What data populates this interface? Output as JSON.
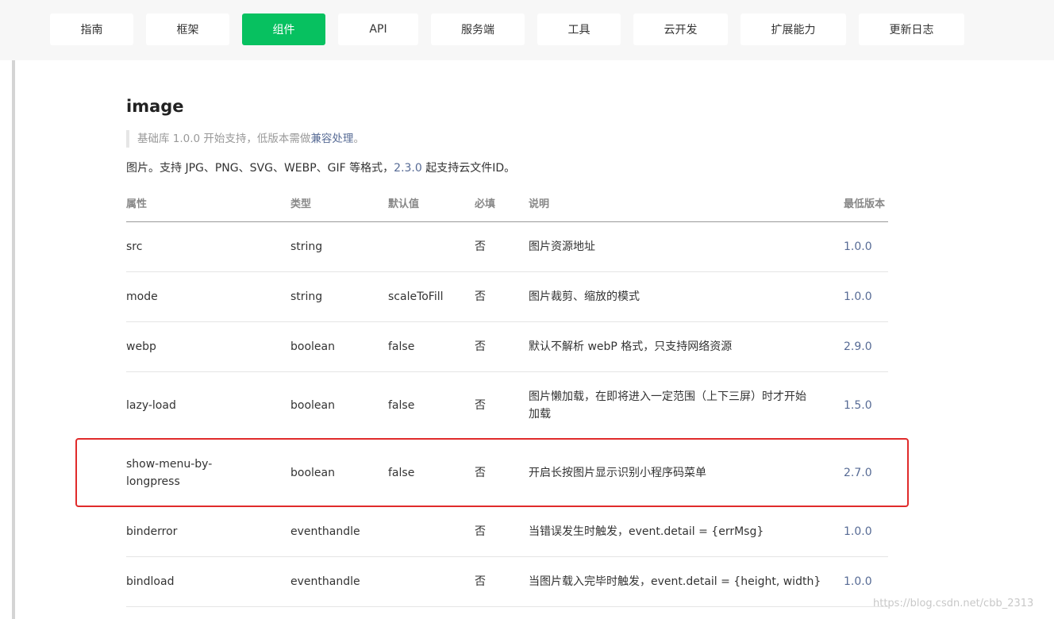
{
  "nav": {
    "items": [
      {
        "label": "指南",
        "active": false
      },
      {
        "label": "框架",
        "active": false
      },
      {
        "label": "组件",
        "active": true
      },
      {
        "label": "API",
        "active": false
      },
      {
        "label": "服务端",
        "active": false
      },
      {
        "label": "工具",
        "active": false
      },
      {
        "label": "云开发",
        "active": false
      },
      {
        "label": "扩展能力",
        "active": false
      },
      {
        "label": "更新日志",
        "active": false
      }
    ]
  },
  "page": {
    "title": "image",
    "note_prefix": "基础库 1.0.0 开始支持，低版本需做",
    "note_link": "兼容处理",
    "note_suffix": "。",
    "desc_prefix": "图片。支持 JPG、PNG、SVG、WEBP、GIF 等格式，",
    "desc_version": "2.3.0",
    "desc_suffix": " 起支持云文件ID。"
  },
  "table": {
    "headers": {
      "attr": "属性",
      "type": "类型",
      "default": "默认值",
      "required": "必填",
      "description": "说明",
      "min_version": "最低版本"
    },
    "rows": [
      {
        "attr": "src",
        "type": "string",
        "default": "",
        "required": "否",
        "description": "图片资源地址",
        "min_version": "1.0.0"
      },
      {
        "attr": "mode",
        "type": "string",
        "default": "scaleToFill",
        "required": "否",
        "description": "图片裁剪、缩放的模式",
        "min_version": "1.0.0"
      },
      {
        "attr": "webp",
        "type": "boolean",
        "default": "false",
        "required": "否",
        "description": "默认不解析 webP 格式，只支持网络资源",
        "min_version": "2.9.0"
      },
      {
        "attr": "lazy-load",
        "type": "boolean",
        "default": "false",
        "required": "否",
        "description": "图片懒加载，在即将进入一定范围（上下三屏）时才开始加载",
        "description_line1": "图片懒加载，在即将进入一定范围（上下三屏）时才开始",
        "description_line2": "加载",
        "min_version": "1.5.0"
      },
      {
        "attr": "show-menu-by-longpress",
        "attr_line1": "show-menu-by-",
        "attr_line2": "longpress",
        "type": "boolean",
        "default": "false",
        "required": "否",
        "description": "开启长按图片显示识别小程序码菜单",
        "min_version": "2.7.0"
      },
      {
        "attr": "binderror",
        "type": "eventhandle",
        "default": "",
        "required": "否",
        "description": "当错误发生时触发，event.detail = {errMsg}",
        "min_version": "1.0.0"
      },
      {
        "attr": "bindload",
        "type": "eventhandle",
        "default": "",
        "required": "否",
        "description": "当图片载入完毕时触发，event.detail = {height, width}",
        "min_version": "1.0.0"
      }
    ]
  },
  "watermark": "https://blog.csdn.net/cbb_2313",
  "colors": {
    "accent": "#07c160",
    "link": "#576b95",
    "highlight_border": "#e02b2b"
  }
}
